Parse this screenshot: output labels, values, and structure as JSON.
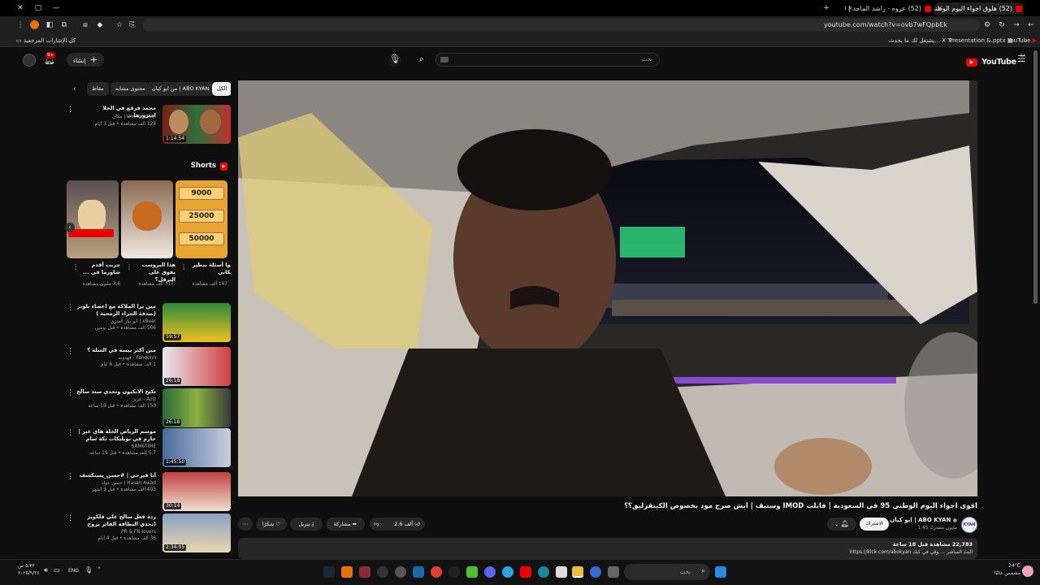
{
  "browser": {
    "tabs": [
      {
        "title": "(52) هلوق اجواء اليوم الوطني 95"
      },
      {
        "title": "(52) عروه - راشد الماجد | 2013 م"
      }
    ],
    "url": "youtube.com/watch?v=ovb7wFQpbEk",
    "bookmarks": {
      "youtube": "YouTube",
      "presentation": "Presentation &.pptx",
      "x_item": "يشتغل لك ما يحدث... X",
      "all_bookmarks": "كل الإشارات المرجعية"
    }
  },
  "youtube": {
    "logo_text": "YouTube",
    "logo_region": "SA",
    "search_placeholder": "بحث",
    "create_label": "إنشاء",
    "notif_count": "9+"
  },
  "chips": [
    "الكل",
    "من ابو كيان | ABO KYAN",
    "محتوى مشابه",
    "مقاط"
  ],
  "videos_top": [
    {
      "title": "محمد فرقع في الحلا امبرورها...",
      "channel": "UncleHattan | مكان",
      "meta": "128 ألف مشاهدة • قبل 3 أيام",
      "duration": "1:14:54"
    }
  ],
  "shorts_label": "Shorts",
  "shorts": [
    {
      "title": "أقوا أسئلة بنطير منكاني",
      "views": "197 ألف مشاهدة",
      "nums": [
        "9000",
        "25000",
        "50000"
      ]
    },
    {
      "title": "هذا البروست بفوق على البرقل؟",
      "views": "317 ألف مشاهدة"
    },
    {
      "title": "جربت أقدم شاورما في ...",
      "views": "3.6 مليون مشاهدة"
    }
  ],
  "videos": [
    {
      "title": "مين يرا الملاكة مع اعضاء بلوتر (صدفة الجزاء الرمحية )",
      "channel": "xBear | أبو بيار العنزي",
      "meta": "566 ألف مشاهدة • قبل يومين",
      "duration": "59:57"
    },
    {
      "title": "مين أكبر بيسة في الشلة ؟",
      "channel": "Fahdonh - فهدونه",
      "meta": "1 ألف مشاهدة • قبل 6 أيام",
      "duration": "26:18"
    },
    {
      "title": "نكبح الانكيون وتحدي سند سالح",
      "channel": "Aziz - عزيز",
      "meta": "150 ألف مشاهدة • قبل 19 ساعة",
      "duration": "26:18"
    },
    {
      "title": "موسم الرياض الحلة هاي عير | حارم في بوبليكات تكة سام",
      "channel": "SAM6TIME",
      "meta": "5.7 ألف مشاهدة • قبل 19 ساعة",
      "duration": "1:45:50"
    },
    {
      "title": "أنا فيرجي | #حسن_يستكشف",
      "channel": "Hasan Awad | حسن عواد",
      "meta": "403 ألف مشاهدة • قبل 3 أشهر",
      "duration": "30:14"
    },
    {
      "title": "ردة فعل سالح على فلكويز (تحدي البطاقة القائر يروح الغرفة الثاني )",
      "channel": "PR & FN lovers",
      "meta": "36 ألف مشاهدة • قبل 4 أيام",
      "duration": "2:34:05"
    }
  ],
  "video": {
    "title": "اقوى اجواء اليوم الوطني 95 في السعودية | قابلت IMOD وستيف | ايش صرح مود بخصوص الكينقزليق؟؟",
    "channel": "ابو كيان | ABO KYAN",
    "subscribers": "1.45 مليون مشترك",
    "subscribe_label": "الاشتراك",
    "likes": "2.6 ألف",
    "share_label": "مشاركة",
    "download_label": "تنزيل",
    "thanks_label": "شكرًا",
    "views_line": "22,783 مشاهدة قبل 18 ساعة",
    "desc_line": "البث المباشر ... وفي في كيك https://kick.com/abokyan"
  },
  "taskbar": {
    "time": "٥:٣٢ ص",
    "date": "٢٠٢٥/٩/٢٤",
    "lang": "ENG",
    "search": "بحث",
    "weather_temp": "24°C",
    "weather_desc": "مشمس غالبًا"
  }
}
